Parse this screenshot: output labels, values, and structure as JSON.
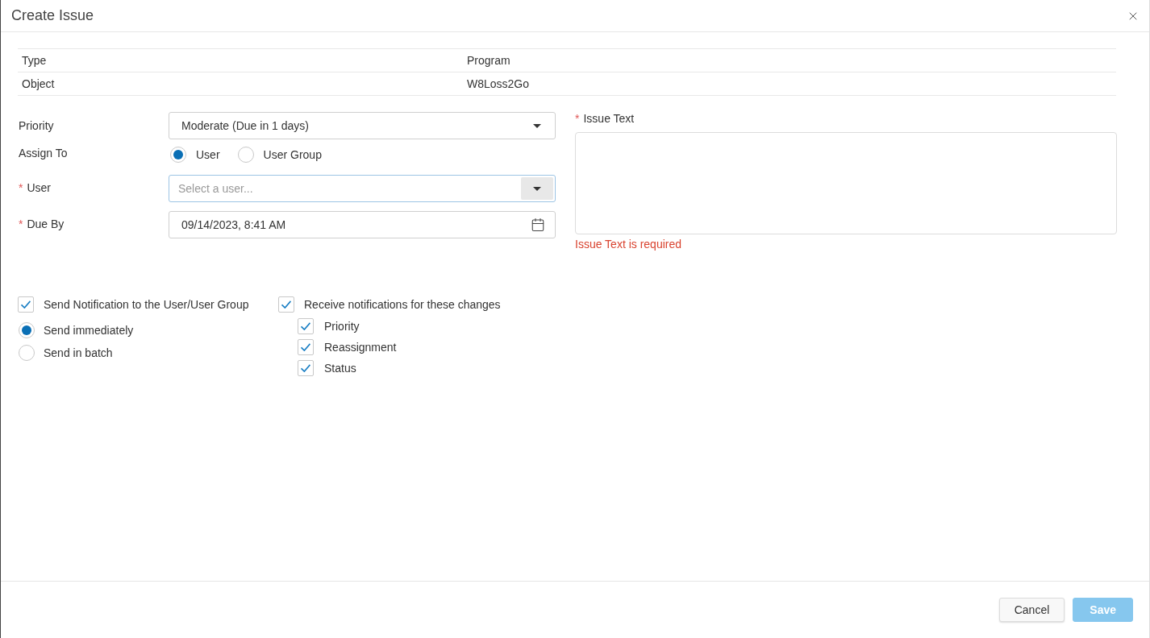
{
  "dialog": {
    "title": "Create Issue"
  },
  "info_table": {
    "rows": [
      {
        "label": "Type",
        "value": "Program"
      },
      {
        "label": "Object",
        "value": "W8Loss2Go"
      }
    ]
  },
  "form": {
    "priority": {
      "label": "Priority",
      "value": "Moderate (Due in 1 days)"
    },
    "assign_to": {
      "label": "Assign To",
      "options": [
        {
          "label": "User",
          "selected": true
        },
        {
          "label": "User Group",
          "selected": false
        }
      ]
    },
    "user": {
      "label": "User",
      "required_mark": "*",
      "placeholder": "Select a user...",
      "focused": true
    },
    "due_by": {
      "label": "Due By",
      "required_mark": "*",
      "value": "09/14/2023, 8:41 AM"
    },
    "issue_text": {
      "label": "Issue Text",
      "required_mark": "*",
      "error": "Issue Text is required"
    }
  },
  "notifications": {
    "send_notification": {
      "label": "Send Notification to the User/User Group",
      "checked": true
    },
    "send_mode": [
      {
        "label": "Send immediately",
        "selected": true
      },
      {
        "label": "Send in batch",
        "selected": false
      }
    ],
    "receive_changes": {
      "label": "Receive notifications for these changes",
      "checked": true,
      "items": [
        {
          "label": "Priority",
          "checked": true
        },
        {
          "label": "Reassignment",
          "checked": true
        },
        {
          "label": "Status",
          "checked": true
        }
      ]
    }
  },
  "buttons": [
    {
      "label": "Cancel",
      "kind": "secondary",
      "disabled": false
    },
    {
      "label": "Save",
      "kind": "primary",
      "disabled": true
    }
  ]
}
